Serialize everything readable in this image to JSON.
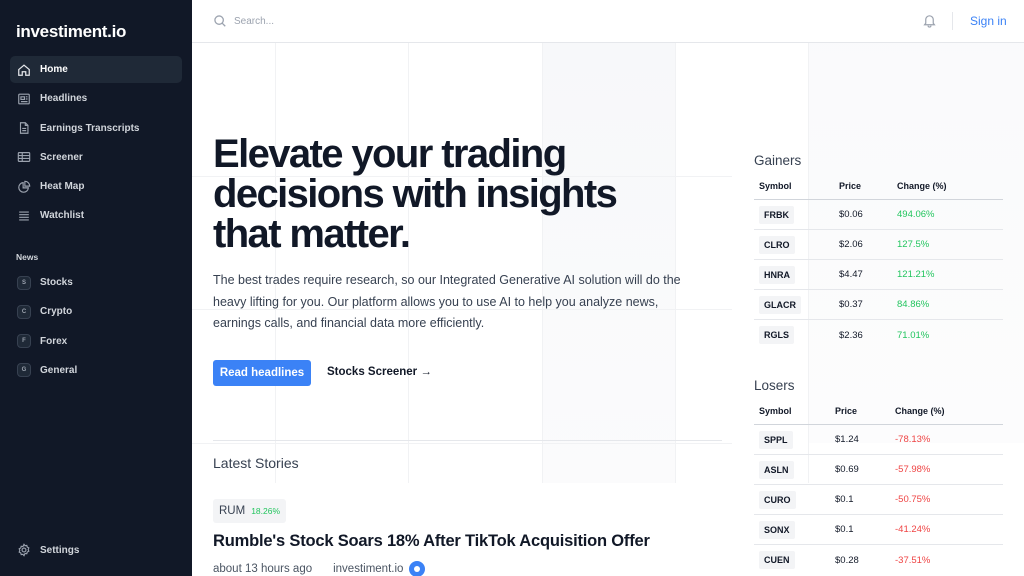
{
  "brand": "investiment.io",
  "nav": [
    {
      "label": "Home",
      "icon": "home-icon",
      "active": true
    },
    {
      "label": "Headlines",
      "icon": "newspaper-icon"
    },
    {
      "label": "Earnings Transcripts",
      "icon": "document-icon"
    },
    {
      "label": "Screener",
      "icon": "table-icon"
    },
    {
      "label": "Heat Map",
      "icon": "pie-chart-icon"
    },
    {
      "label": "Watchlist",
      "icon": "list-icon"
    }
  ],
  "news_section": {
    "title": "News",
    "items": [
      {
        "letter": "S",
        "label": "Stocks"
      },
      {
        "letter": "C",
        "label": "Crypto"
      },
      {
        "letter": "F",
        "label": "Forex"
      },
      {
        "letter": "G",
        "label": "General"
      }
    ]
  },
  "settings_label": "Settings",
  "search": {
    "placeholder": "Search..."
  },
  "signin_label": "Sign in",
  "hero": {
    "title": "Elevate your trading decisions with insights that matter.",
    "description": "The best trades require research, so our Integrated Generative AI solution will do the heavy lifting for you. Our platform allows you to use AI to help you analyze news, earnings calls, and financial data more efficiently.",
    "primary_button": "Read headlines",
    "secondary_link": "Stocks Screener →"
  },
  "latest": {
    "title": "Latest Stories",
    "story": {
      "ticker": "RUM",
      "change": "18.26%",
      "headline": "Rumble's Stock Soars 18% After TikTok Acquisition Offer",
      "time": "about 13 hours ago",
      "source": "investiment.io"
    }
  },
  "gainers": {
    "title": "Gainers",
    "columns": [
      "Symbol",
      "Price",
      "Change (%)"
    ],
    "rows": [
      {
        "symbol": "FRBK",
        "price": "$0.06",
        "change": "494.06%"
      },
      {
        "symbol": "CLRO",
        "price": "$2.06",
        "change": "127.5%"
      },
      {
        "symbol": "HNRA",
        "price": "$4.47",
        "change": "121.21%"
      },
      {
        "symbol": "GLACR",
        "price": "$0.37",
        "change": "84.86%"
      },
      {
        "symbol": "RGLS",
        "price": "$2.36",
        "change": "71.01%"
      }
    ]
  },
  "losers": {
    "title": "Losers",
    "columns": [
      "Symbol",
      "Price",
      "Change (%)"
    ],
    "rows": [
      {
        "symbol": "SPPL",
        "price": "$1.24",
        "change": "-78.13%"
      },
      {
        "symbol": "ASLN",
        "price": "$0.69",
        "change": "-57.98%"
      },
      {
        "symbol": "CURO",
        "price": "$0.1",
        "change": "-50.75%"
      },
      {
        "symbol": "SONX",
        "price": "$0.1",
        "change": "-41.24%"
      },
      {
        "symbol": "CUEN",
        "price": "$0.28",
        "change": "-37.51%"
      }
    ]
  },
  "colors": {
    "sidebar_bg": "#111827",
    "accent": "#3b82f6",
    "positive": "#22c55e",
    "negative": "#ef4444"
  }
}
